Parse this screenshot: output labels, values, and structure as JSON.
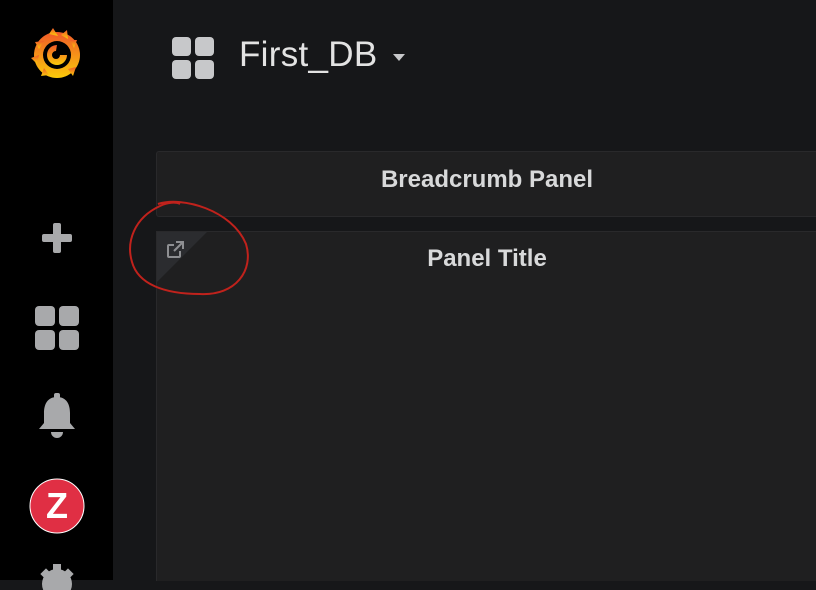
{
  "sidebar": {
    "items": [
      {
        "icon": "grafana-logo-icon"
      },
      {
        "icon": "plus-icon"
      },
      {
        "icon": "dashboards-grid-icon"
      },
      {
        "icon": "bell-icon"
      },
      {
        "icon": "user-avatar-z",
        "label": "Z"
      },
      {
        "icon": "gear-icon"
      }
    ]
  },
  "header": {
    "dashboard_title": "First_DB"
  },
  "panels": [
    {
      "title": "Breadcrumb Panel"
    },
    {
      "title": "Panel Title",
      "link_icon": "external-link-icon"
    }
  ],
  "colors": {
    "background": "#161719",
    "sidebar": "#000000",
    "panel": "#1f1f20",
    "avatar": "#e02f44",
    "annotation": "#c0221c"
  }
}
